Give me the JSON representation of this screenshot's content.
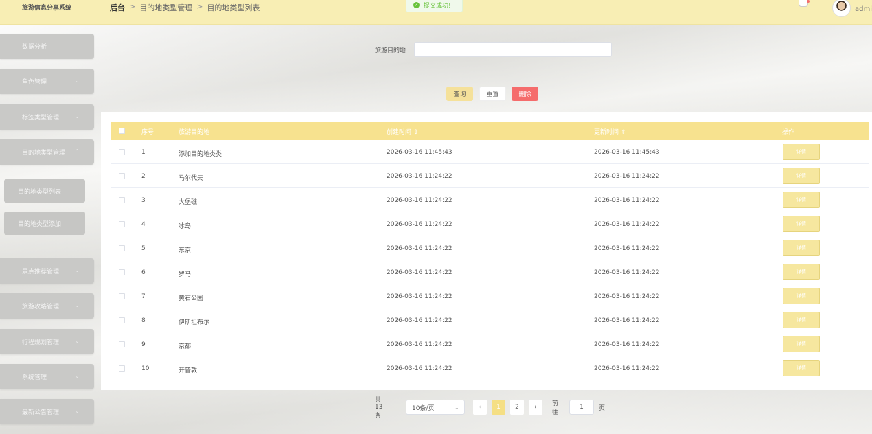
{
  "app": {
    "title": "旅游信息分享系统"
  },
  "breadcrumb": {
    "home": "后台",
    "level1": "目的地类型管理",
    "level2": "目的地类型列表",
    "separator": ">"
  },
  "toast": {
    "message": "提交成功!"
  },
  "user": {
    "name": "admin"
  },
  "sidebar": {
    "items": [
      {
        "label": "数据分析",
        "expandable": false
      },
      {
        "label": "角色管理",
        "expandable": true
      },
      {
        "label": "标签类型管理",
        "expandable": true
      },
      {
        "label": "目的地类型管理",
        "expandable": true,
        "expanded": true
      },
      {
        "label": "景点推荐管理",
        "expandable": true
      },
      {
        "label": "旅游攻略管理",
        "expandable": true
      },
      {
        "label": "行程规划管理",
        "expandable": true
      },
      {
        "label": "系统管理",
        "expandable": true
      },
      {
        "label": "最新公告管理",
        "expandable": true
      }
    ],
    "subitems": [
      {
        "label": "目的地类型列表",
        "active": true
      },
      {
        "label": "目的地类型添加",
        "active": false
      }
    ]
  },
  "search": {
    "label": "旅游目的地",
    "value": "",
    "placeholder": ""
  },
  "buttons": {
    "query": "查询",
    "reset": "重置",
    "delete": "删除"
  },
  "table": {
    "headers": {
      "index": "序号",
      "destination": "旅游目的地",
      "created": "创建时间",
      "updated": "更新时间",
      "action": "操作"
    },
    "sort_icon": "⇕",
    "action_label": "详情",
    "rows": [
      {
        "index": "1",
        "destination": "添加目的地类类",
        "created": "2026-03-16 11:45:43",
        "updated": "2026-03-16 11:45:43"
      },
      {
        "index": "2",
        "destination": "马尔代夫",
        "created": "2026-03-16 11:24:22",
        "updated": "2026-03-16 11:24:22"
      },
      {
        "index": "3",
        "destination": "大堡礁",
        "created": "2026-03-16 11:24:22",
        "updated": "2026-03-16 11:24:22"
      },
      {
        "index": "4",
        "destination": "冰岛",
        "created": "2026-03-16 11:24:22",
        "updated": "2026-03-16 11:24:22"
      },
      {
        "index": "5",
        "destination": "东京",
        "created": "2026-03-16 11:24:22",
        "updated": "2026-03-16 11:24:22"
      },
      {
        "index": "6",
        "destination": "罗马",
        "created": "2026-03-16 11:24:22",
        "updated": "2026-03-16 11:24:22"
      },
      {
        "index": "7",
        "destination": "黄石公园",
        "created": "2026-03-16 11:24:22",
        "updated": "2026-03-16 11:24:22"
      },
      {
        "index": "8",
        "destination": "伊斯坦布尔",
        "created": "2026-03-16 11:24:22",
        "updated": "2026-03-16 11:24:22"
      },
      {
        "index": "9",
        "destination": "京都",
        "created": "2026-03-16 11:24:22",
        "updated": "2026-03-16 11:24:22"
      },
      {
        "index": "10",
        "destination": "开普敦",
        "created": "2026-03-16 11:24:22",
        "updated": "2026-03-16 11:24:22"
      }
    ]
  },
  "pagination": {
    "total_text": "共 13 条",
    "page_size": "10条/页",
    "pages": [
      "1",
      "2"
    ],
    "current_page": "1",
    "prev": "‹",
    "next": "›",
    "goto_label": "前往",
    "goto_value": "1",
    "page_suffix": "页"
  },
  "colors": {
    "accent": "#f7e28f",
    "topbar": "#f8eeb4",
    "danger": "#f56c6c",
    "success": "#67c23a"
  }
}
